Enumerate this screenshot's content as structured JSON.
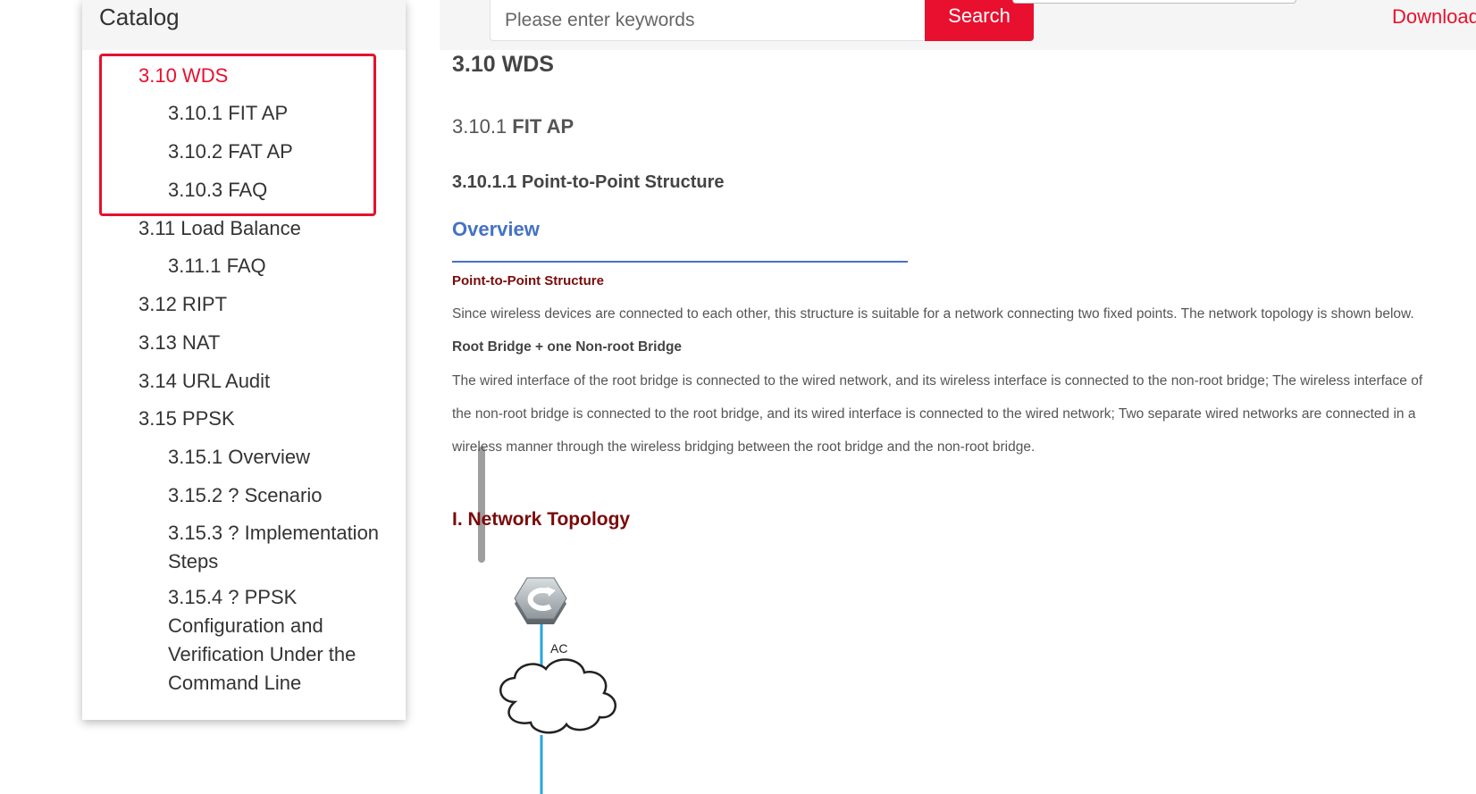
{
  "catalog": {
    "title": "Catalog",
    "items": [
      {
        "label": "3.10 WDS",
        "level": 1,
        "active": true
      },
      {
        "label": "3.10.1 FIT AP",
        "level": 2
      },
      {
        "label": "3.10.2 FAT AP",
        "level": 2
      },
      {
        "label": "3.10.3 FAQ",
        "level": 2
      },
      {
        "label": "3.11 Load Balance",
        "level": 1
      },
      {
        "label": "3.11.1 FAQ",
        "level": 2
      },
      {
        "label": "3.12 RIPT",
        "level": 1
      },
      {
        "label": "3.13 NAT",
        "level": 1
      },
      {
        "label": "3.14 URL Audit",
        "level": 1
      },
      {
        "label": "3.15 PPSK",
        "level": 1
      },
      {
        "label": "3.15.1 Overview",
        "level": 2
      },
      {
        "label": "3.15.2 ? Scenario",
        "level": 2
      },
      {
        "label": "3.15.3 ? Implementation Steps",
        "level": 2
      },
      {
        "label": "3.15.4 ? PPSK Configuration and Verification Under the Command Line",
        "level": 2
      }
    ]
  },
  "header": {
    "search_placeholder": "Please enter keywords",
    "search_button": "Search",
    "download_label": "Download"
  },
  "content": {
    "section_title": "3.10 WDS",
    "sub_title_num": "3.10.1 ",
    "sub_title_text": "FIT AP",
    "subsub_title": "3.10.1.1 Point-to-Point Structure",
    "overview": "Overview",
    "pp_heading": "Point-to-Point Structure",
    "para1": "Since wireless devices are connected to each other, this structure is suitable for a network connecting two fixed points. The network topology is shown below.",
    "bold_line": "Root Bridge + one Non-root Bridge",
    "para2_line1": "The wired interface of the root bridge is connected to the wired network, and its wireless interface is connected to the non-root bridge; The wireless interface of",
    "para2_line2": "the non-root bridge is connected to the root bridge, and its wired interface is connected to the wired network; Two separate wired networks are connected in a",
    "para2_line3": "wireless manner through the wireless bridging between the root bridge and the non-root bridge.",
    "topology_heading": "I. Network Topology",
    "ac_label": "AC"
  },
  "colors": {
    "accent_red": "#e8102e",
    "overview_blue": "#4472c4",
    "heading_maroon": "#7b0a0a",
    "link_line_blue": "#29a3e0"
  }
}
